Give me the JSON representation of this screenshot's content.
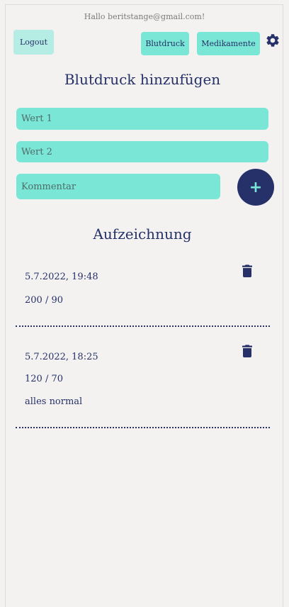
{
  "header": {
    "greeting": "Hallo beritstange@gmail.com!",
    "logout_label": "Logout",
    "nav": [
      "Blutdruck",
      "Medikamente"
    ],
    "settings_icon": "gear-icon"
  },
  "form": {
    "title": "Blutdruck hinzufügen",
    "wert1_placeholder": "Wert 1",
    "wert2_placeholder": "Wert 2",
    "kommentar_placeholder": "Kommentar",
    "add_label": "+"
  },
  "records": {
    "title": "Aufzeichnung",
    "entries": [
      {
        "datetime": "5.7.2022, 19:48",
        "value": "200 / 90",
        "comment": ""
      },
      {
        "datetime": "5.7.2022, 18:25",
        "value": "120 / 70",
        "comment": "alles normal"
      }
    ]
  },
  "colors": {
    "accent": "#7ae6d6",
    "primary": "#253168",
    "background": "#f3f2f0"
  }
}
